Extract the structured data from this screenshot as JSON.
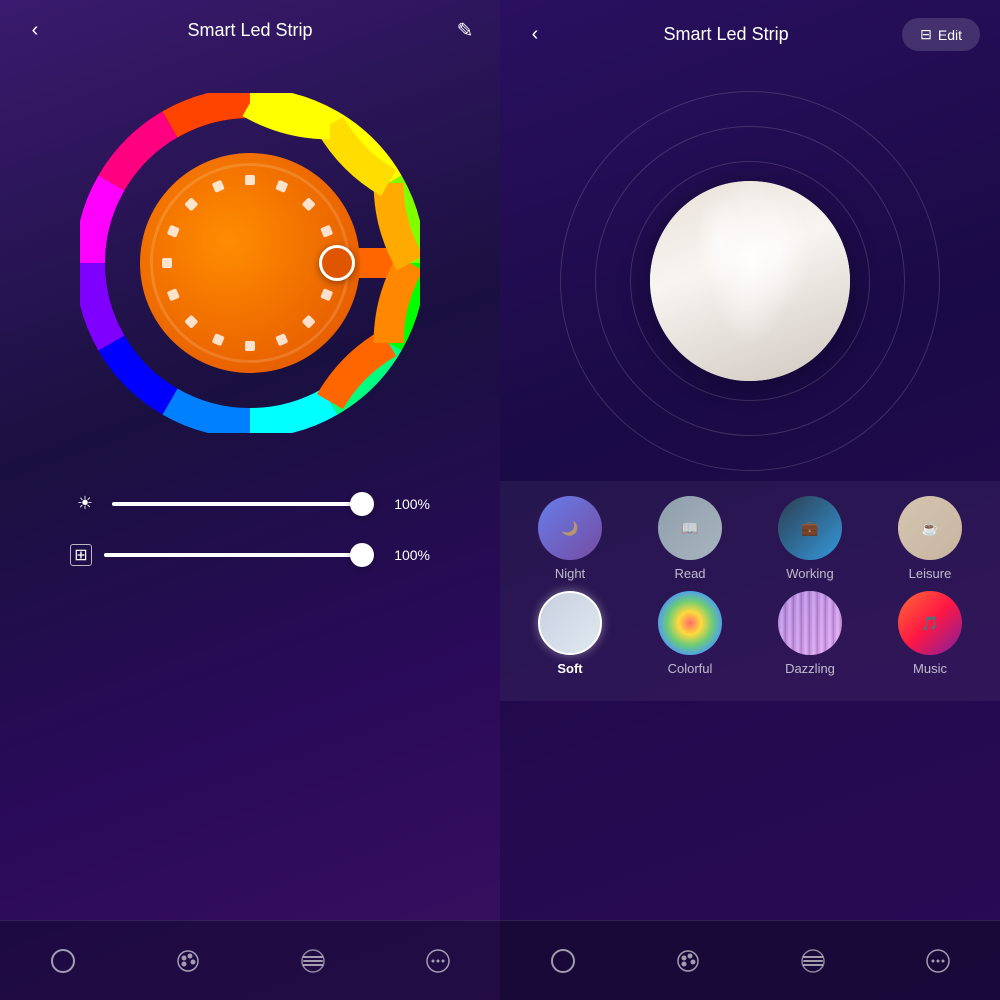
{
  "left": {
    "title": "Smart Led Strip",
    "back_label": "‹",
    "edit_label": "✎",
    "color_wheel": {
      "selected_color": "#e05500"
    },
    "sliders": [
      {
        "id": "brightness",
        "icon": "☀",
        "value": 100,
        "label": "100%",
        "fill_percent": 100
      },
      {
        "id": "contrast",
        "icon": "⊙",
        "value": 100,
        "label": "100%",
        "fill_percent": 100
      }
    ],
    "nav_items": [
      {
        "id": "power",
        "icon": "○",
        "active": false
      },
      {
        "id": "palette",
        "icon": "◉",
        "active": false
      },
      {
        "id": "menu",
        "icon": "≡",
        "active": false
      },
      {
        "id": "more",
        "icon": "⋯",
        "active": false
      }
    ]
  },
  "right": {
    "title": "Smart Led Strip",
    "back_label": "‹",
    "edit_button_label": "Edit",
    "edit_icon": "⊟",
    "active_scene": "Soft",
    "scenes_row1": [
      {
        "id": "night",
        "label": "Night",
        "active": false
      },
      {
        "id": "read",
        "label": "Read",
        "active": false
      },
      {
        "id": "working",
        "label": "Working",
        "active": false
      },
      {
        "id": "leisure",
        "label": "Leisure",
        "active": false
      }
    ],
    "scenes_row2": [
      {
        "id": "soft",
        "label": "Soft",
        "active": true
      },
      {
        "id": "colorful",
        "label": "Colorful",
        "active": false
      },
      {
        "id": "dazzling",
        "label": "Dazzling",
        "active": false
      },
      {
        "id": "music",
        "label": "Music",
        "active": false
      }
    ],
    "nav_items": [
      {
        "id": "power",
        "icon": "○",
        "active": false
      },
      {
        "id": "palette",
        "icon": "◉",
        "active": false
      },
      {
        "id": "menu",
        "icon": "≡",
        "active": false
      },
      {
        "id": "more",
        "icon": "⋯",
        "active": false
      }
    ]
  }
}
